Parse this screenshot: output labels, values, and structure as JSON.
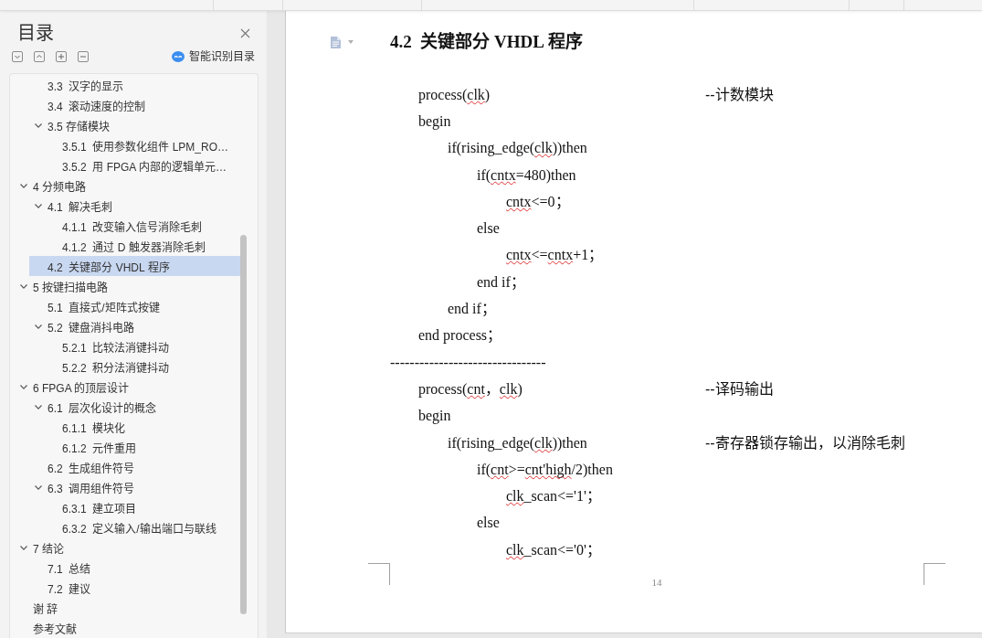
{
  "sidebar": {
    "title": "目录",
    "smart_toc_link": "智能识别目录",
    "toc": [
      {
        "children": [
          {
            "label": "3.3  汉字的显示",
            "selected": false
          },
          {
            "label": "3.4  滚动速度的控制",
            "selected": false
          },
          {
            "label": "3.5 存储模块",
            "selected": false,
            "expanded": true,
            "children": [
              {
                "label": "3.5.1  使用参数化组件 LPM_RO…",
                "selected": false
              },
              {
                "label": "3.5.2  用 FPGA 内部的逻辑单元…",
                "selected": false
              }
            ]
          }
        ]
      },
      {
        "label": "4 分频电路",
        "selected": false,
        "expanded": true,
        "children": [
          {
            "label": "4.1  解决毛刺",
            "selected": false,
            "expanded": true,
            "children": [
              {
                "label": "4.1.1  改变输入信号消除毛刺",
                "selected": false
              },
              {
                "label": "4.1.2  通过 D 触发器消除毛刺",
                "selected": false
              }
            ]
          },
          {
            "label": "4.2  关键部分 VHDL 程序",
            "selected": true
          }
        ]
      },
      {
        "label": "5 按键扫描电路",
        "selected": false,
        "expanded": true,
        "children": [
          {
            "label": "5.1  直接式/矩阵式按键",
            "selected": false
          },
          {
            "label": "5.2  键盘消抖电路",
            "selected": false,
            "expanded": true,
            "children": [
              {
                "label": "5.2.1  比较法消键抖动",
                "selected": false
              },
              {
                "label": "5.2.2  积分法消键抖动",
                "selected": false
              }
            ]
          }
        ]
      },
      {
        "label": "6 FPGA 的顶层设计",
        "selected": false,
        "expanded": true,
        "children": [
          {
            "label": "6.1  层次化设计的概念",
            "selected": false,
            "expanded": true,
            "children": [
              {
                "label": "6.1.1  模块化",
                "selected": false
              },
              {
                "label": "6.1.2  元件重用",
                "selected": false
              }
            ]
          },
          {
            "label": "6.2  生成组件符号",
            "selected": false
          },
          {
            "label": "6.3  调用组件符号",
            "selected": false,
            "expanded": true,
            "children": [
              {
                "label": "6.3.1  建立项目",
                "selected": false
              },
              {
                "label": "6.3.2  定义输入/输出端口与联线",
                "selected": false
              }
            ]
          }
        ]
      },
      {
        "label": "7 结论",
        "selected": false,
        "expanded": true,
        "children": [
          {
            "label": "7.1  总结",
            "selected": false
          },
          {
            "label": "7.2  建议",
            "selected": false
          }
        ]
      },
      {
        "label": "谢 辞",
        "selected": false
      },
      {
        "label": "参考文献",
        "selected": false
      }
    ]
  },
  "document": {
    "heading": "4.2  关键部分 VHDL 程序",
    "body": [
      {
        "kind": "code",
        "lines": [
          {
            "segments": [
              {
                "text": "process(",
                "misspelled": false
              },
              {
                "text": "clk",
                "misspelled": true
              },
              {
                "text": ")",
                "misspelled": false
              }
            ],
            "comment": "--计数模块"
          },
          {
            "segments": [
              {
                "text": "begin",
                "misspelled": false
              }
            ],
            "children": [
              {
                "segments": [
                  {
                    "text": "if(rising_edge(",
                    "misspelled": false
                  },
                  {
                    "text": "clk",
                    "misspelled": true
                  },
                  {
                    "text": "))then",
                    "misspelled": false
                  }
                ],
                "children": [
                  {
                    "segments": [
                      {
                        "text": "if(",
                        "misspelled": false
                      },
                      {
                        "text": "cntx",
                        "misspelled": true
                      },
                      {
                        "text": "=480)then",
                        "misspelled": false
                      }
                    ],
                    "children": [
                      {
                        "segments": [
                          {
                            "text": "cntx",
                            "misspelled": true
                          },
                          {
                            "text": "<=0；",
                            "misspelled": false
                          }
                        ]
                      }
                    ]
                  },
                  {
                    "segments": [
                      {
                        "text": "else",
                        "misspelled": false
                      }
                    ],
                    "children": [
                      {
                        "segments": [
                          {
                            "text": "cntx",
                            "misspelled": true
                          },
                          {
                            "text": "<=",
                            "misspelled": false
                          },
                          {
                            "text": "cntx",
                            "misspelled": true
                          },
                          {
                            "text": "+1；",
                            "misspelled": false
                          }
                        ]
                      }
                    ]
                  },
                  {
                    "segments": [
                      {
                        "text": "end if；",
                        "misspelled": false
                      }
                    ]
                  }
                ]
              },
              {
                "segments": [
                  {
                    "text": "end if；",
                    "misspelled": false
                  }
                ]
              }
            ]
          },
          {
            "segments": [
              {
                "text": "end process；",
                "misspelled": false
              }
            ]
          }
        ]
      },
      {
        "kind": "rule",
        "text": "--------------------------------"
      },
      {
        "kind": "code",
        "lines": [
          {
            "segments": [
              {
                "text": "process(",
                "misspelled": false
              },
              {
                "text": "cnt",
                "misspelled": true
              },
              {
                "text": "，",
                "misspelled": false
              },
              {
                "text": "clk",
                "misspelled": true
              },
              {
                "text": ")",
                "misspelled": false
              }
            ],
            "comment": "--译码输出"
          },
          {
            "segments": [
              {
                "text": "begin",
                "misspelled": false
              }
            ],
            "children": [
              {
                "segments": [
                  {
                    "text": "if(rising_edge(",
                    "misspelled": false
                  },
                  {
                    "text": "clk",
                    "misspelled": true
                  },
                  {
                    "text": "))then",
                    "misspelled": false
                  }
                ],
                "comment": "--寄存器锁存输出，以消除毛刺",
                "children": [
                  {
                    "segments": [
                      {
                        "text": "if(",
                        "misspelled": false
                      },
                      {
                        "text": "cnt",
                        "misspelled": true
                      },
                      {
                        "text": ">=",
                        "misspelled": false
                      },
                      {
                        "text": "cnt'high",
                        "misspelled": true
                      },
                      {
                        "text": "/2)then",
                        "misspelled": false
                      }
                    ],
                    "children": [
                      {
                        "segments": [
                          {
                            "text": "clk",
                            "misspelled": true
                          },
                          {
                            "text": "_scan<='1'；",
                            "misspelled": false
                          }
                        ]
                      }
                    ]
                  },
                  {
                    "segments": [
                      {
                        "text": "else",
                        "misspelled": false
                      }
                    ],
                    "children": [
                      {
                        "segments": [
                          {
                            "text": "clk",
                            "misspelled": true
                          },
                          {
                            "text": "_scan<='0'；",
                            "misspelled": false
                          }
                        ]
                      }
                    ]
                  }
                ]
              }
            ]
          }
        ]
      }
    ],
    "page_number": "14"
  }
}
